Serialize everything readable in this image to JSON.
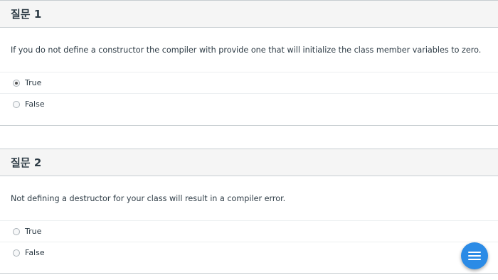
{
  "questions": [
    {
      "title": "질문 1",
      "text": "If you do not define a constructor the compiler with provide one that will initialize the class member variables to zero.",
      "answers": [
        {
          "label": "True",
          "selected": true
        },
        {
          "label": "False",
          "selected": false
        }
      ]
    },
    {
      "title": "질문 2",
      "text": "Not defining a destructor for your class will result in a compiler error.",
      "answers": [
        {
          "label": "True",
          "selected": false
        },
        {
          "label": "False",
          "selected": false
        }
      ]
    }
  ],
  "fab": {
    "icon": "menu-icon",
    "color": "#2b8be6"
  }
}
